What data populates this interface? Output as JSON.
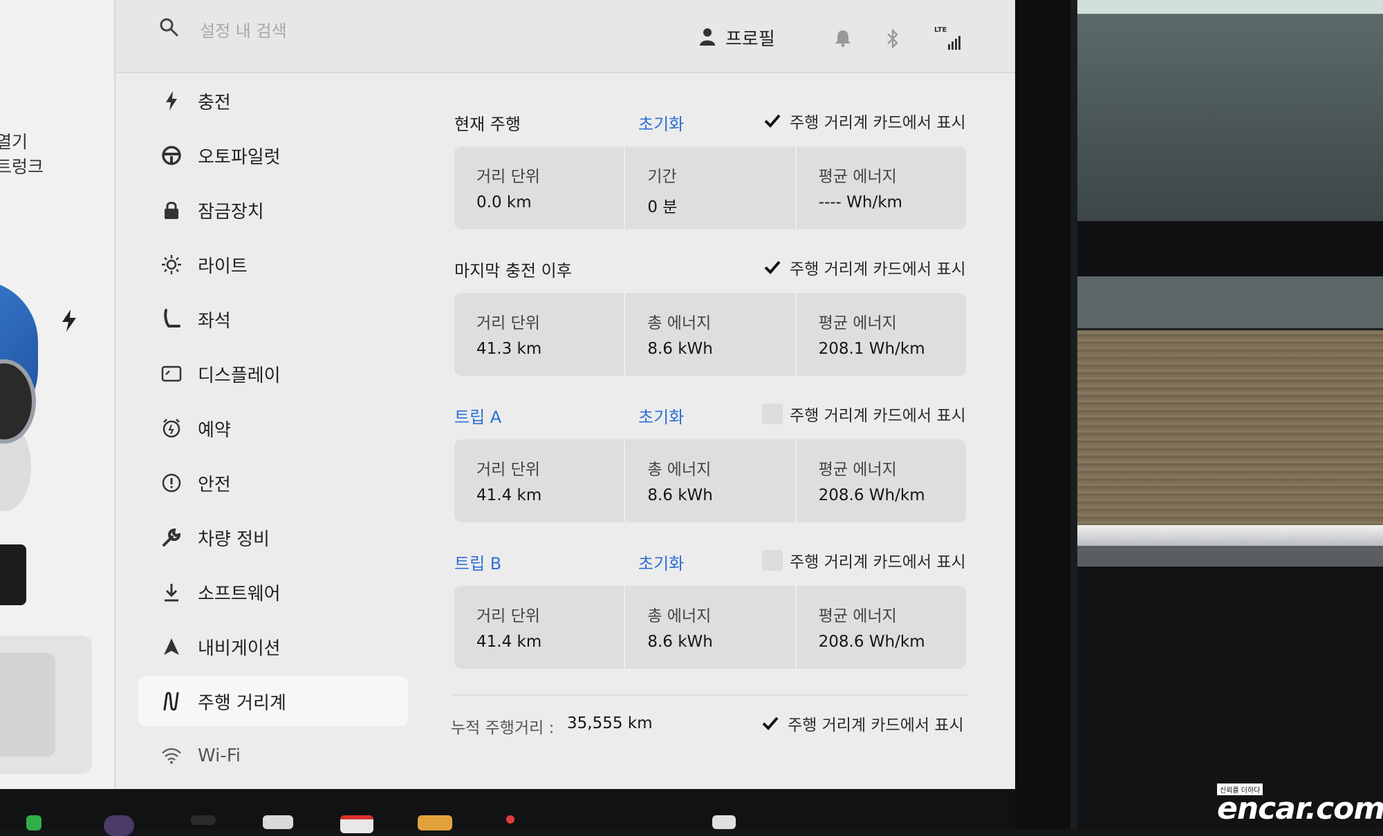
{
  "header": {
    "search_placeholder": "설정 내 검색",
    "profile_label": "프로필",
    "lte_label": "LTE"
  },
  "left_panel": {
    "labels": [
      "열기",
      "트렁크"
    ]
  },
  "sidebar": {
    "items": [
      {
        "label": "충전",
        "icon": "bolt-icon"
      },
      {
        "label": "오토파일럿",
        "icon": "steering-wheel-icon"
      },
      {
        "label": "잠금장치",
        "icon": "lock-icon"
      },
      {
        "label": "라이트",
        "icon": "sun-icon"
      },
      {
        "label": "좌석",
        "icon": "seat-icon"
      },
      {
        "label": "디스플레이",
        "icon": "display-icon"
      },
      {
        "label": "예약",
        "icon": "clock-icon"
      },
      {
        "label": "안전",
        "icon": "warning-icon"
      },
      {
        "label": "차량 정비",
        "icon": "wrench-icon"
      },
      {
        "label": "소프트웨어",
        "icon": "download-icon"
      },
      {
        "label": "내비게이션",
        "icon": "navigation-icon"
      },
      {
        "label": "주행 거리계",
        "icon": "odometer-icon",
        "active": true
      },
      {
        "label": "Wi-Fi",
        "icon": "wifi-icon"
      }
    ]
  },
  "sections": [
    {
      "title": "현재 주행",
      "reset_label": "초기화",
      "checked": true,
      "check_label": "주행 거리계 카드에서 표시",
      "cells": [
        {
          "label": "거리 단위",
          "value": "0.0 km"
        },
        {
          "label": "기간",
          "value": "0 분"
        },
        {
          "label": "평균 에너지",
          "value": "---- Wh/km"
        }
      ]
    },
    {
      "title": "마지막 충전 이후",
      "checked": true,
      "check_label": "주행 거리계 카드에서 표시",
      "cells": [
        {
          "label": "거리 단위",
          "value": "41.3 km"
        },
        {
          "label": "총 에너지",
          "value": "8.6 kWh"
        },
        {
          "label": "평균 에너지",
          "value": "208.1 Wh/km"
        }
      ]
    },
    {
      "title": "트립 A",
      "reset_label": "초기화",
      "checked": false,
      "check_label": "주행 거리계 카드에서 표시",
      "cells": [
        {
          "label": "거리 단위",
          "value": "41.4 km"
        },
        {
          "label": "총 에너지",
          "value": "8.6 kWh"
        },
        {
          "label": "평균 에너지",
          "value": "208.6 Wh/km"
        }
      ]
    },
    {
      "title": "트립 B",
      "reset_label": "초기화",
      "checked": false,
      "check_label": "주행 거리계 카드에서 표시",
      "cells": [
        {
          "label": "거리 단위",
          "value": "41.4 km"
        },
        {
          "label": "총 에너지",
          "value": "8.6 kWh"
        },
        {
          "label": "평균 에너지",
          "value": "208.6 Wh/km"
        }
      ]
    }
  ],
  "odometer": {
    "label": "누적 주행거리 :",
    "value": "35,555 km",
    "checked": true,
    "check_label": "주행 거리계 카드에서 표시"
  },
  "watermark": {
    "tagline": "신뢰를 더하다",
    "brand": "encar.com"
  },
  "colors": {
    "accent_blue": "#2f6fd6",
    "screen_bg": "#ececec",
    "card_bg": "#dedede"
  }
}
